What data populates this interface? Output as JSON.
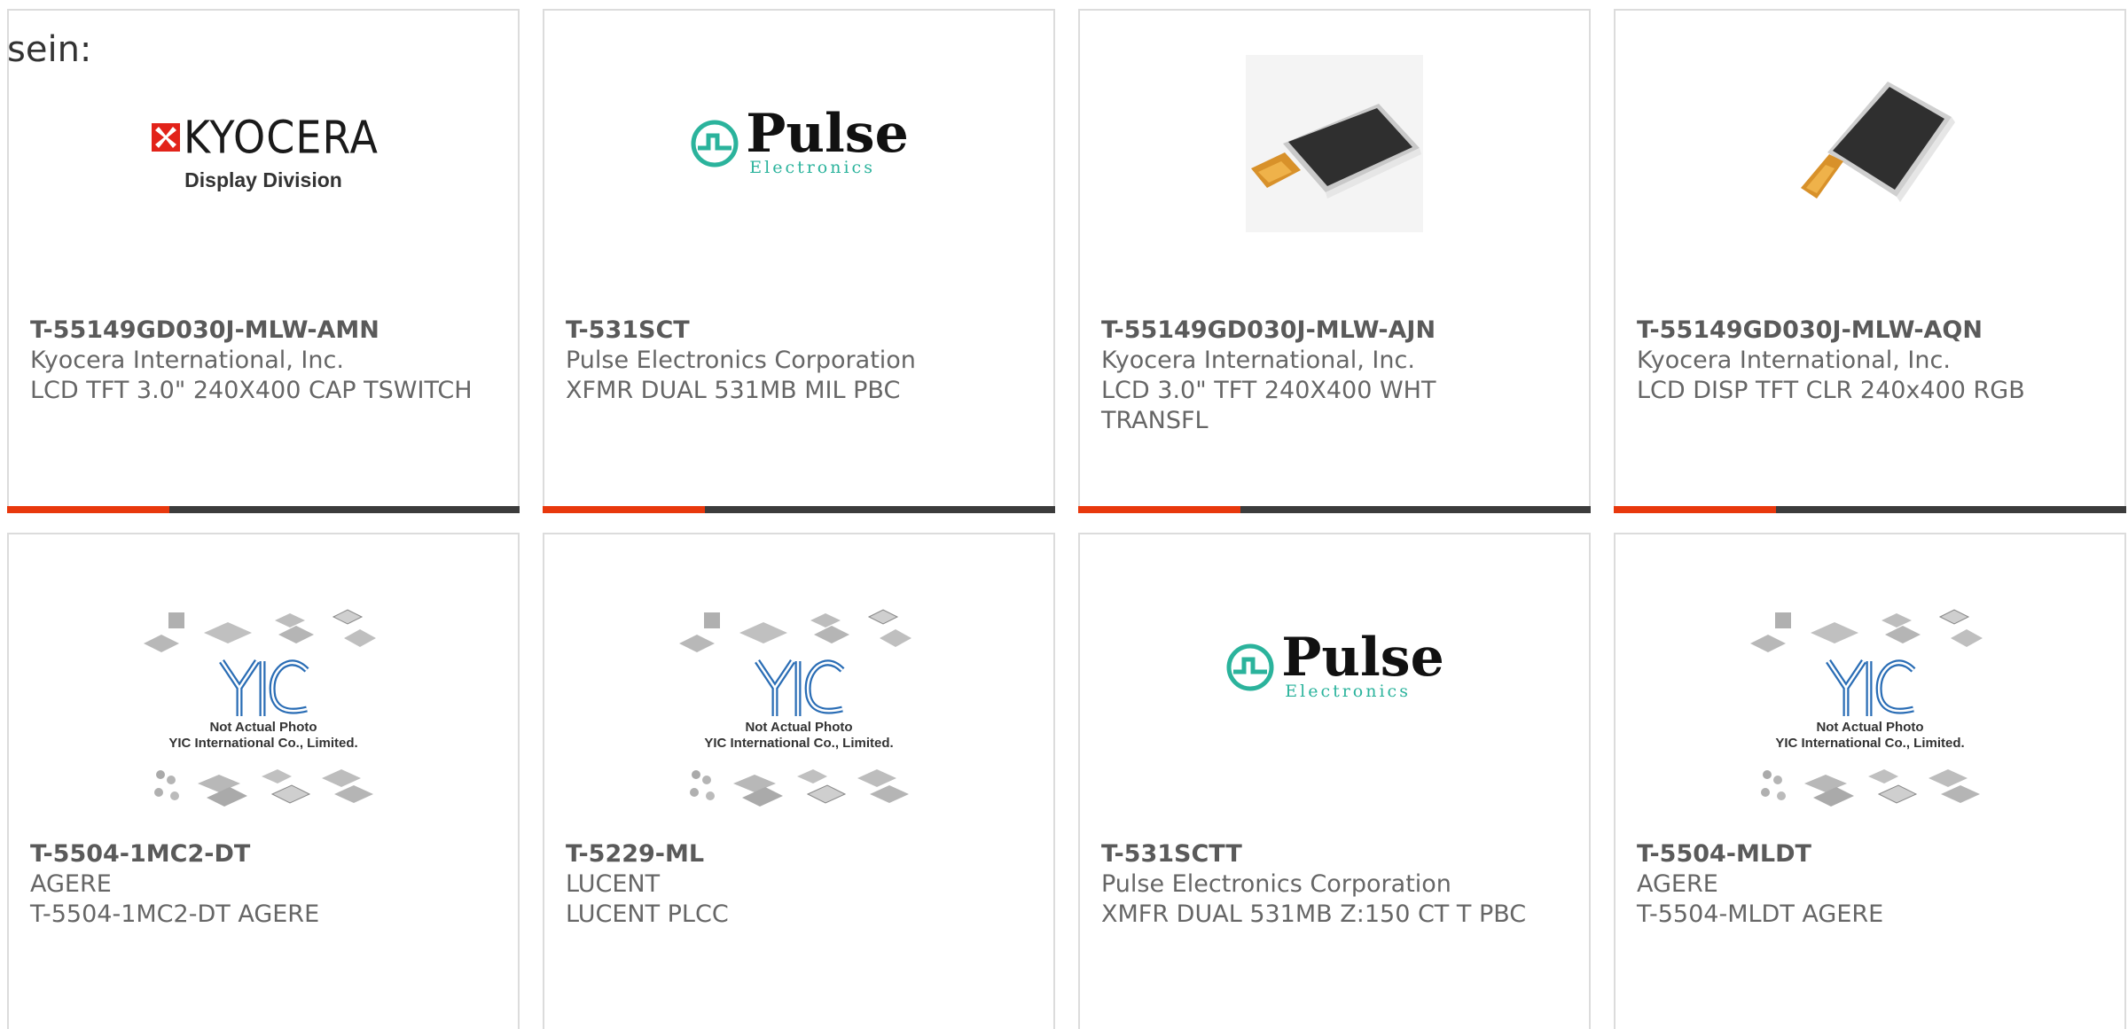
{
  "intro": "sein:",
  "logos": {
    "kyocera_word": "KYOCERA",
    "kyocera_sub": "Display Division",
    "pulse_word": "Pulse",
    "pulse_sub": "Electronics",
    "yic_line1": "Not Actual Photo",
    "yic_line2": "YIC International Co., Limited."
  },
  "colors": {
    "accent": "#e8380d",
    "bar": "#3c3c3c",
    "pulse_teal": "#2bb39c",
    "kyocera_red": "#e2231a"
  },
  "products": [
    {
      "part": "T-55149GD030J-MLW-AMN",
      "manufacturer": "Kyocera International, Inc.",
      "description": "LCD TFT 3.0\" 240X400 CAP TSWITCH",
      "image": "kyocera-logo"
    },
    {
      "part": "T-531SCT",
      "manufacturer": "Pulse Electronics Corporation",
      "description": "XFMR DUAL 531MB MIL PBC",
      "image": "pulse-logo"
    },
    {
      "part": "T-55149GD030J-MLW-AJN",
      "manufacturer": "Kyocera International, Inc.",
      "description": "LCD 3.0\" TFT 240X400 WHT TRANSFL",
      "image": "lcd-photo"
    },
    {
      "part": "T-55149GD030J-MLW-AQN",
      "manufacturer": "Kyocera International, Inc.",
      "description": "LCD DISP TFT CLR 240x400 RGB",
      "image": "lcd-photo"
    },
    {
      "part": "T-5504-1MC2-DT",
      "manufacturer": "AGERE",
      "description": "T-5504-1MC2-DT AGERE",
      "image": "yic-placeholder"
    },
    {
      "part": "T-5229-ML",
      "manufacturer": "LUCENT",
      "description": "LUCENT PLCC",
      "image": "yic-placeholder"
    },
    {
      "part": "T-531SCTT",
      "manufacturer": "Pulse Electronics Corporation",
      "description": "XMFR DUAL 531MB Z:150 CT T PBC",
      "image": "pulse-logo"
    },
    {
      "part": "T-5504-MLDT",
      "manufacturer": "AGERE",
      "description": "T-5504-MLDT AGERE",
      "image": "yic-placeholder"
    }
  ]
}
